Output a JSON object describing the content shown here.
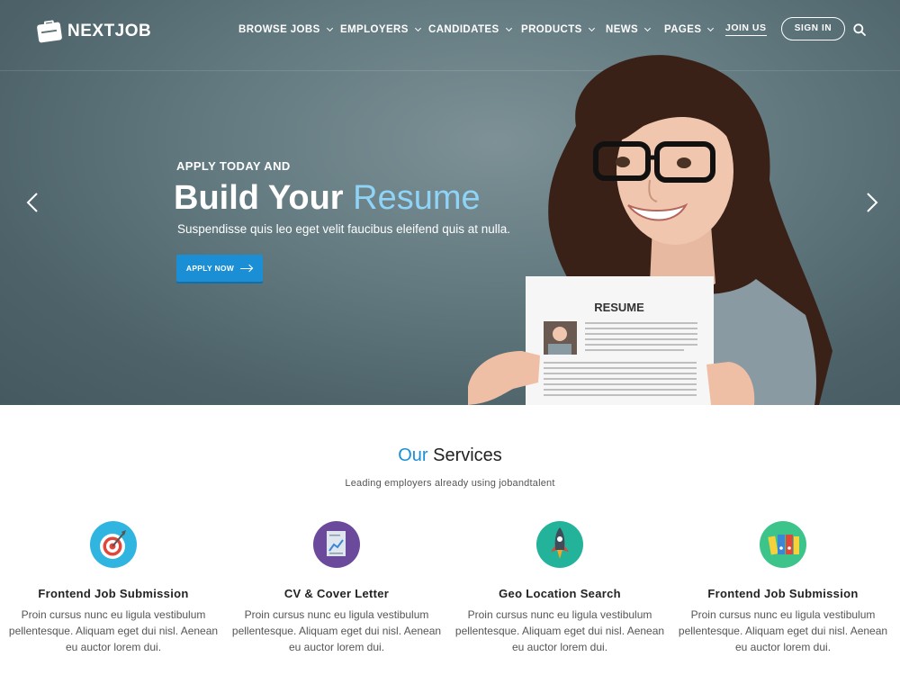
{
  "brand": {
    "name": "NEXTJOB"
  },
  "nav": {
    "items": [
      {
        "label": "BROWSE JOBS",
        "has_dropdown": true
      },
      {
        "label": "EMPLOYERS",
        "has_dropdown": true
      },
      {
        "label": "CANDIDATES",
        "has_dropdown": true
      },
      {
        "label": "PRODUCTS",
        "has_dropdown": true
      },
      {
        "label": "NEWS",
        "has_dropdown": true
      },
      {
        "label": "PAGES",
        "has_dropdown": true
      }
    ],
    "join_label": "JOIN US",
    "signin_label": "SIGN IN",
    "search_icon": "search-icon"
  },
  "hero": {
    "eyebrow": "APPLY TODAY AND",
    "headline_main": "Build Your ",
    "headline_accent": "Resume",
    "subline": "Suspendisse quis leo eget velit faucibus eleifend quis at nulla.",
    "cta_label": "APPLY NOW",
    "resume_card_title": "RESUME",
    "prev_icon": "chevron-left-icon",
    "next_icon": "chevron-right-icon"
  },
  "services": {
    "title_accent": "Our",
    "title_rest": " Services",
    "subtitle": "Leading employers already using jobandtalent",
    "items": [
      {
        "title": "Frontend Job Submission",
        "text": "Proin cursus nunc eu ligula vestibulum pellentesque. Aliquam eget dui nisl. Aenean eu auctor lorem dui.",
        "icon": "target-icon",
        "color": "#2fb5e0"
      },
      {
        "title": "CV & Cover Letter",
        "text": "Proin cursus nunc eu ligula vestibulum pellentesque. Aliquam eget dui nisl. Aenean eu auctor lorem dui.",
        "icon": "document-chart-icon",
        "color": "#6b4a9c"
      },
      {
        "title": "Geo Location Search",
        "text": "Proin cursus nunc eu ligula vestibulum pellentesque. Aliquam eget dui nisl. Aenean eu auctor lorem dui.",
        "icon": "rocket-icon",
        "color": "#23b39a"
      },
      {
        "title": "Frontend Job Submission",
        "text": "Proin cursus nunc eu ligula vestibulum pellentesque. Aliquam eget dui nisl. Aenean eu auctor lorem dui.",
        "icon": "folders-icon",
        "color": "#3cc48a"
      }
    ]
  },
  "colors": {
    "accent": "#1a8fd6",
    "accent_light": "#8fd3f6"
  }
}
